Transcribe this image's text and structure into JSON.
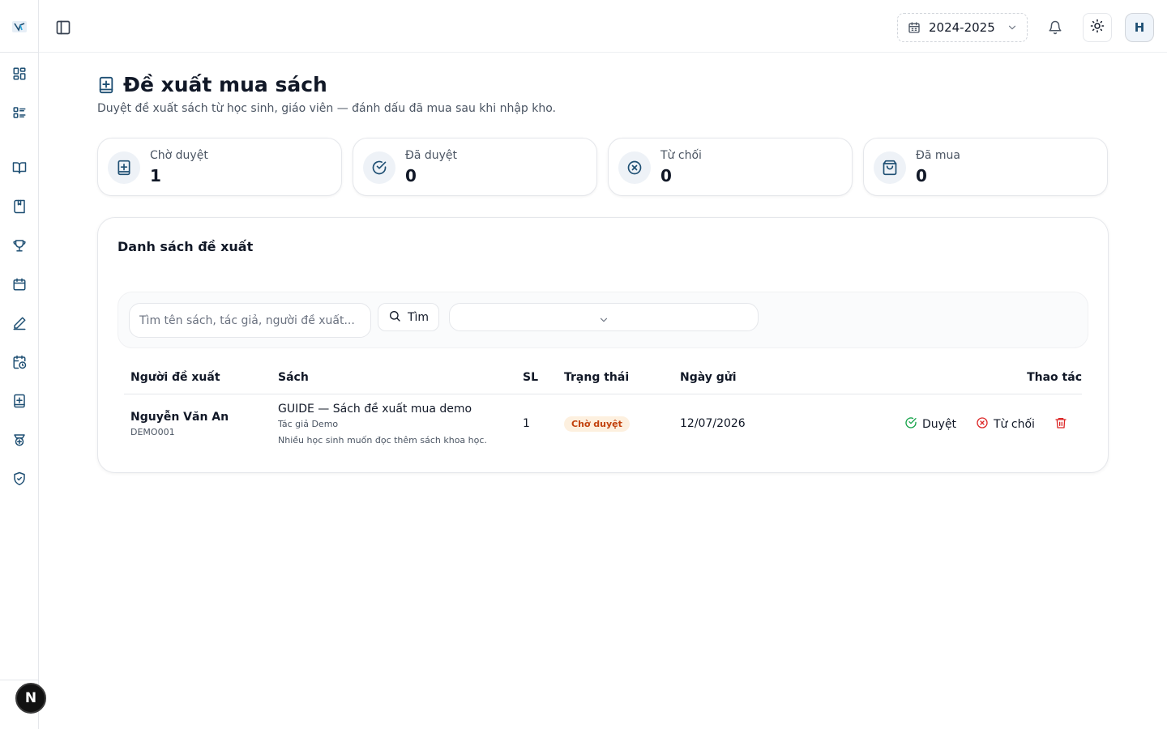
{
  "topbar": {
    "academic_year": "2024-2025",
    "avatar_initial": "H"
  },
  "page": {
    "title": "Đề xuất mua sách",
    "subtitle": "Duyệt đề xuất sách từ học sinh, giáo viên — đánh dấu đã mua sau khi nhập kho."
  },
  "stats": [
    {
      "label": "Chờ duyệt",
      "value": "1",
      "icon": "book-plus-icon"
    },
    {
      "label": "Đã duyệt",
      "value": "0",
      "icon": "check-circle-icon"
    },
    {
      "label": "Từ chối",
      "value": "0",
      "icon": "x-circle-icon"
    },
    {
      "label": "Đã mua",
      "value": "0",
      "icon": "shopping-bag-icon"
    }
  ],
  "list": {
    "title": "Danh sách đề xuất",
    "search_placeholder": "Tìm tên sách, tác giả, người đề xuất...",
    "search_button": "Tìm",
    "status_filter_value": "",
    "columns": {
      "proposer": "Người đề xuất",
      "book": "Sách",
      "qty": "SL",
      "status": "Trạng thái",
      "date": "Ngày gửi",
      "actions": "Thao tác"
    },
    "rows": [
      {
        "name": "Nguyễn Văn An",
        "code": "DEMO001",
        "book_title": "GUIDE — Sách đề xuất mua demo",
        "book_author": "Tác giả Demo",
        "book_note": "Nhiều học sinh muốn đọc thêm sách khoa học.",
        "qty": "1",
        "status": "Chờ duyệt",
        "date": "12/07/2026",
        "approve_label": "Duyệt",
        "reject_label": "Từ chối"
      }
    ]
  },
  "fab_label": "N",
  "colors": {
    "accent": "#1e4f73",
    "status_pending_bg": "#fdf0df",
    "status_pending_text": "#c2410c",
    "approve": "#16a34a",
    "reject": "#dc2626"
  }
}
